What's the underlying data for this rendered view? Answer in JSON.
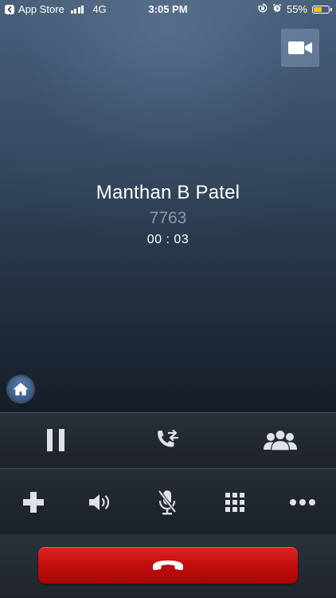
{
  "status_bar": {
    "back_app": "App Store",
    "network": "4G",
    "time": "3:05 PM",
    "battery_percent": "55%",
    "battery_level": 0.55,
    "battery_color": "#f4c21a",
    "icons": [
      "back-arrow-icon",
      "signal-bars-icon",
      "orientation-lock-icon",
      "alarm-icon",
      "battery-icon"
    ]
  },
  "call": {
    "caller_name": "Manthan B Patel",
    "number": "7763",
    "duration": "00 : 03"
  },
  "controls": {
    "top_row": [
      "pause-icon",
      "call-transfer-icon",
      "conference-icon"
    ],
    "bottom_row": [
      "add-call-icon",
      "speaker-icon",
      "mute-mic-icon",
      "keypad-icon",
      "more-options-icon"
    ],
    "end_call_color": "#c20d0d",
    "end_call_icon": "hang-up-icon",
    "video_icon": "video-camera-icon",
    "home_icon": "home-icon"
  }
}
